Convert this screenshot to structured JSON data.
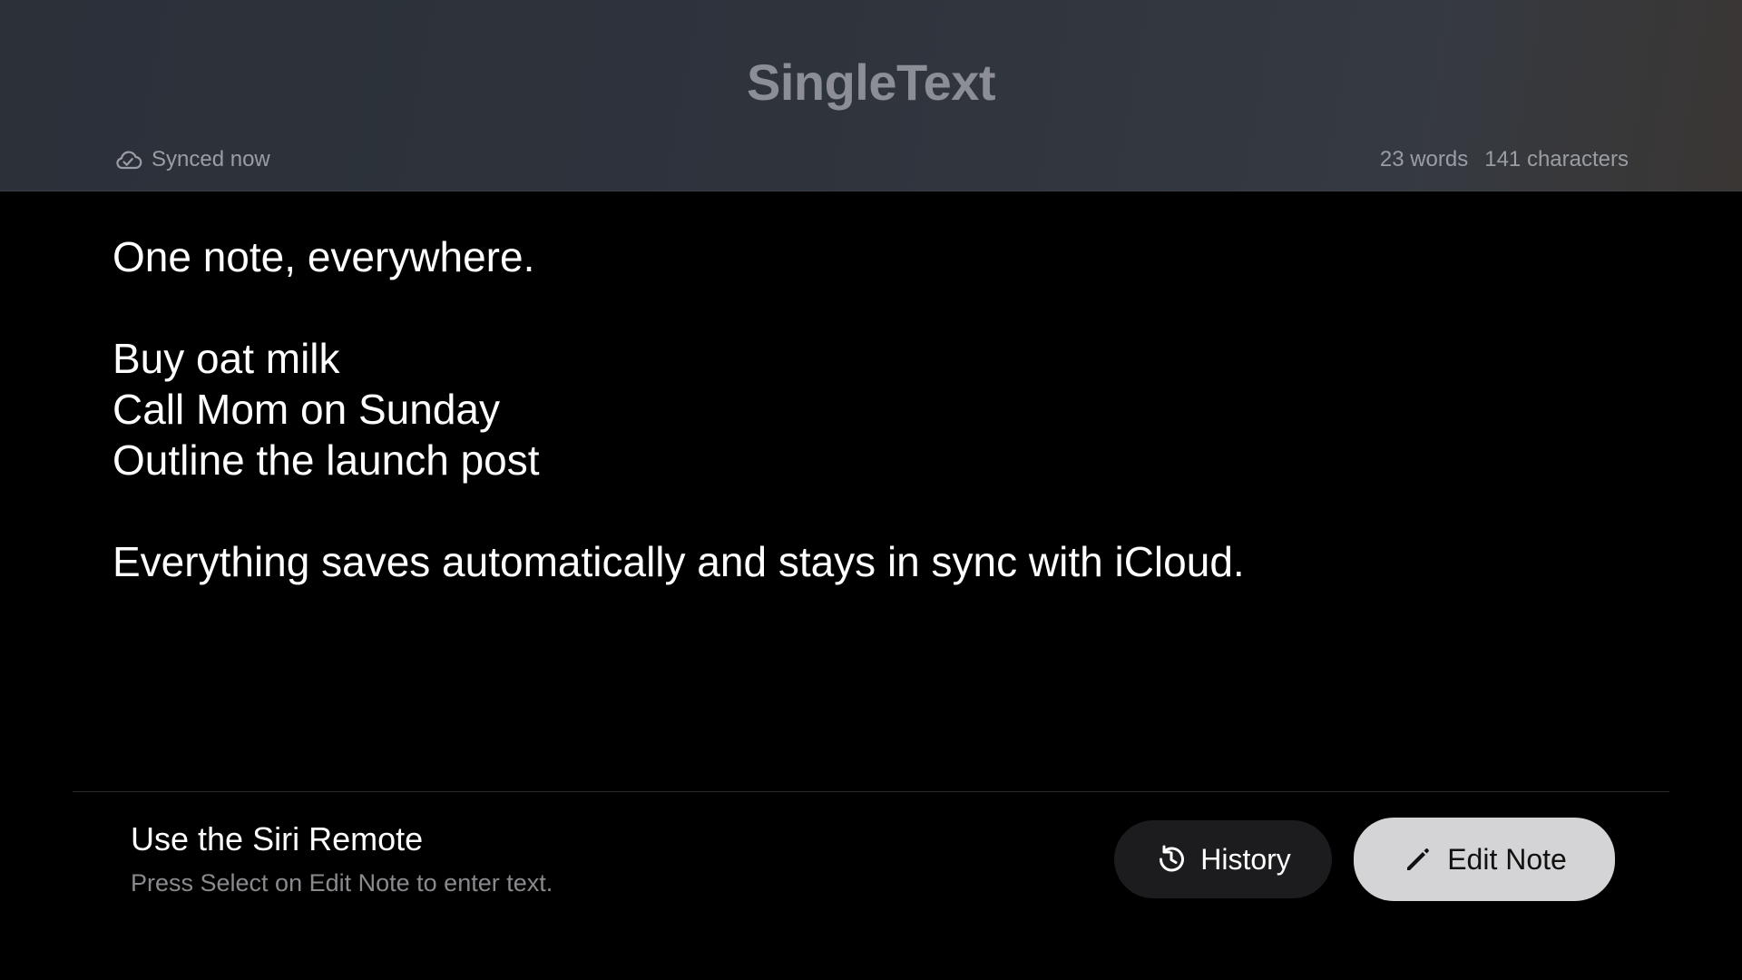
{
  "header": {
    "app_title": "SingleText",
    "sync_status": "Synced now",
    "word_count": "23 words",
    "char_count": "141 characters"
  },
  "note": {
    "lines": [
      "One note, everywhere.",
      "",
      "Buy oat milk",
      "Call Mom on Sunday",
      "Outline the launch post",
      "",
      "Everything saves automatically and stays in sync with iCloud."
    ]
  },
  "footer": {
    "hint_title": "Use the Siri Remote",
    "hint_subtitle": "Press Select on Edit Note to enter text.",
    "history_label": "History",
    "edit_label": "Edit Note"
  },
  "icons": {
    "sync": "cloud-check-icon",
    "history": "history-clock-icon",
    "edit": "pencil-icon"
  },
  "colors": {
    "background": "#000000",
    "header_title": "#8b8e94",
    "focused_button": "#d4d4d6",
    "secondary_button": "#1c1c1e"
  }
}
